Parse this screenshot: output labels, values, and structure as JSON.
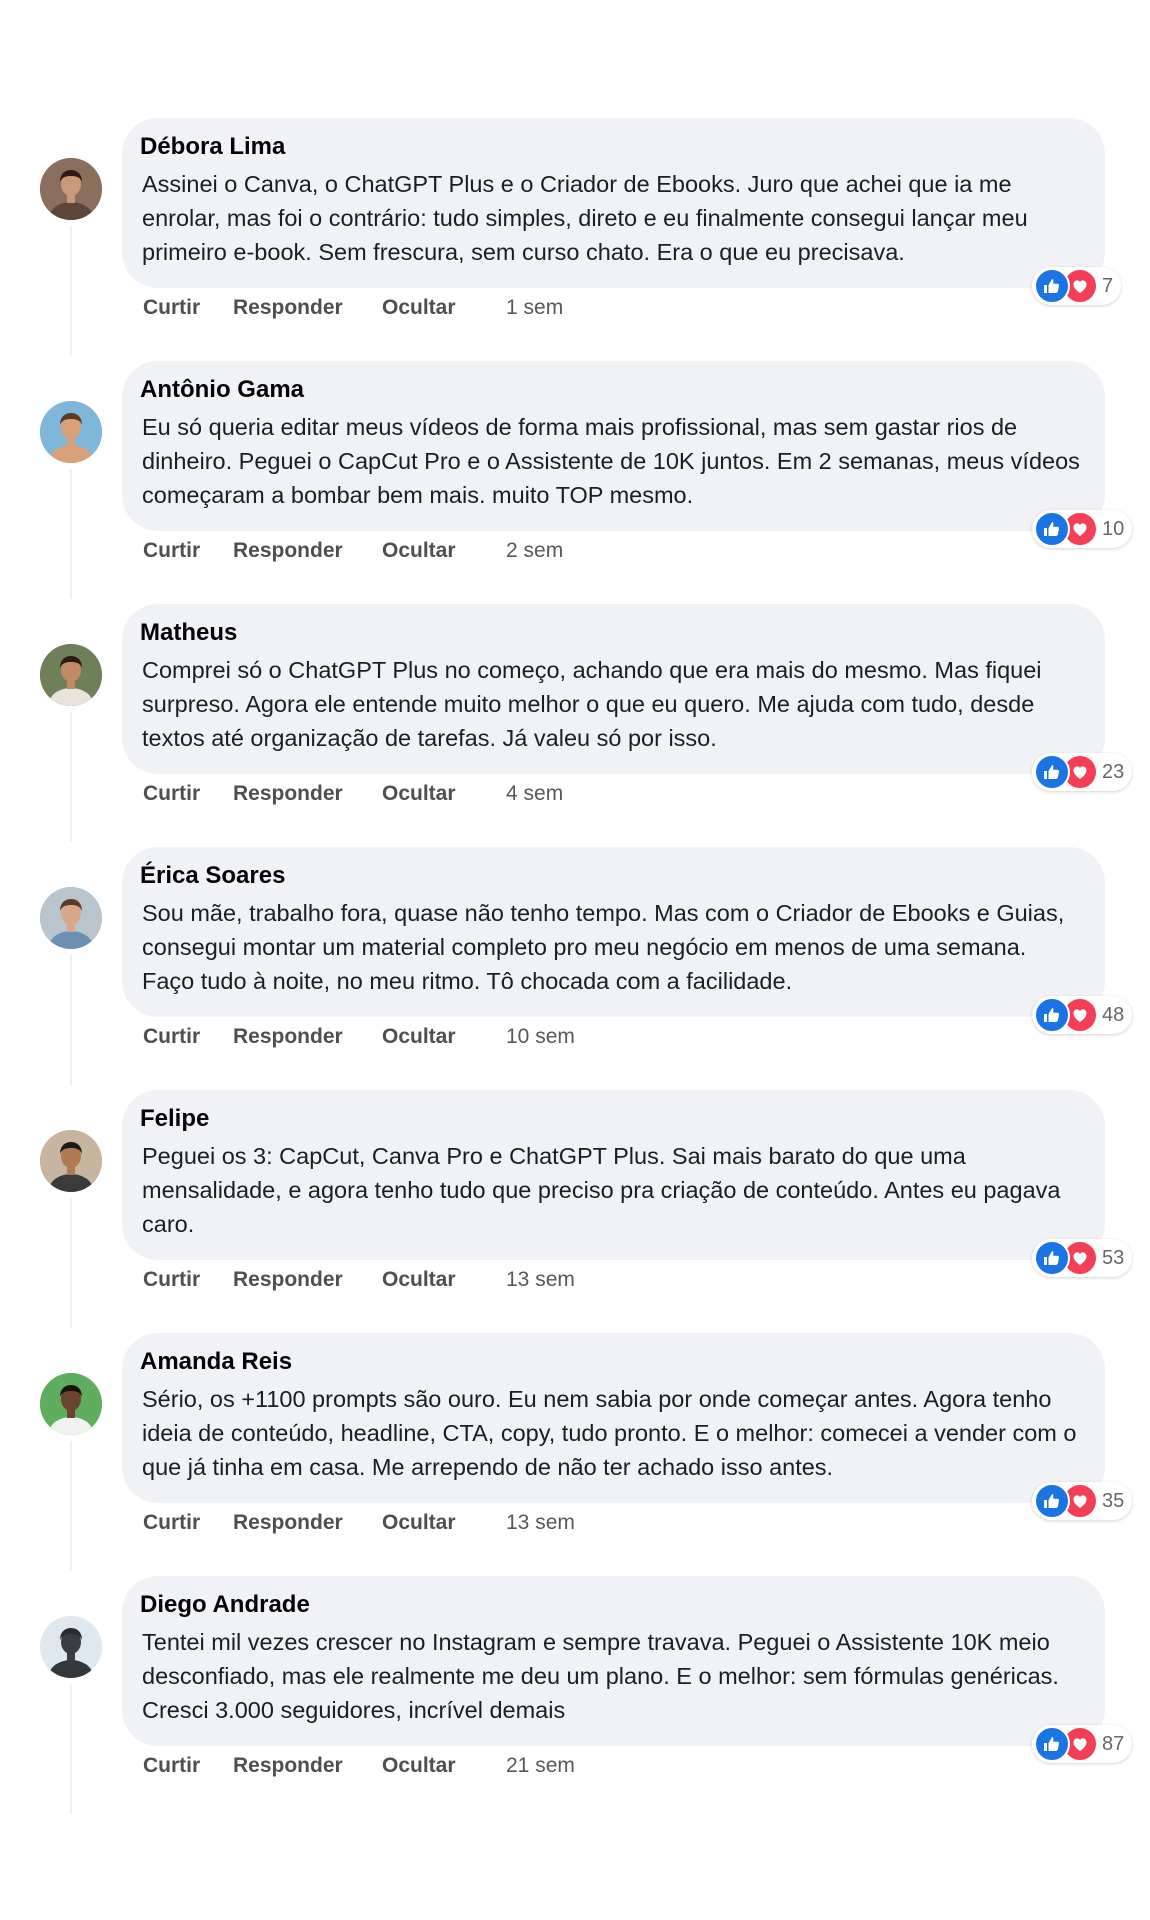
{
  "actions": {
    "like": "Curtir",
    "reply": "Responder",
    "hide": "Ocultar"
  },
  "colors": {
    "like_blue": "#1b74e4",
    "love_red": "#f33e58",
    "bubble_bg": "#f0f2f5"
  },
  "comments": [
    {
      "author": "Débora Lima",
      "text": "Assinei o Canva, o ChatGPT Plus e o Criador de Ebooks. Juro que achei que ia me enrolar, mas foi o contrário: tudo simples, direto e eu finalmente consegui lançar meu primeiro e-book. Sem frescura, sem curso chato. Era o que eu precisava.",
      "time": "1 sem",
      "reactions": "7",
      "avatar": {
        "bg": "#8a6f5c",
        "skin": "#c99a78",
        "hair": "#2c1c14",
        "shirt": "#5b4638"
      }
    },
    {
      "author": "Antônio Gama",
      "text": "Eu só queria editar meus vídeos de forma mais profissional, mas sem gastar rios de dinheiro. Peguei o CapCut Pro e o Assistente de 10K juntos. Em 2 semanas, meus vídeos começaram a bombar bem mais. muito TOP mesmo.",
      "time": "2 sem",
      "reactions": "10",
      "avatar": {
        "bg": "#7fb6d9",
        "skin": "#d9a07a",
        "hair": "#5a3a22",
        "shirt": "#d9a07a"
      }
    },
    {
      "author": "Matheus",
      "text": "Comprei só o ChatGPT Plus no começo, achando que era mais do mesmo. Mas fiquei surpreso. Agora ele entende muito melhor o que eu quero. Me ajuda com tudo, desde textos até organização de tarefas. Já valeu só por isso.",
      "time": "4 sem",
      "reactions": "23",
      "avatar": {
        "bg": "#6f7f5a",
        "skin": "#c08a66",
        "hair": "#2a1d14",
        "shirt": "#e8e4dc"
      }
    },
    {
      "author": "Érica Soares",
      "text": "Sou mãe, trabalho fora, quase não tenho tempo. Mas com o Criador de Ebooks e Guias, consegui montar um material completo pro meu negócio em menos de uma semana. Faço tudo à noite, no meu ritmo. Tô chocada com a facilidade.",
      "time": "10 sem",
      "reactions": "48",
      "avatar": {
        "bg": "#b9c4cc",
        "skin": "#d8a889",
        "hair": "#5c3b26",
        "shirt": "#6b8fb0"
      }
    },
    {
      "author": "Felipe",
      "text": "Peguei os 3: CapCut, Canva Pro e ChatGPT Plus. Sai mais barato do que uma mensalidade, e agora tenho tudo que preciso pra criação de conteúdo. Antes eu pagava caro.",
      "time": "13 sem",
      "reactions": "53",
      "avatar": {
        "bg": "#c7b59f",
        "skin": "#b07a52",
        "hair": "#1e1a17",
        "shirt": "#3b3b3b"
      }
    },
    {
      "author": "Amanda Reis",
      "text": "Sério, os +1100 prompts são ouro. Eu nem sabia por onde começar antes. Agora tenho ideia de conteúdo, headline, CTA, copy, tudo pronto. E o melhor: comecei a vender com o que já tinha em casa. Me arrependo de não ter achado isso antes.",
      "time": "13 sem",
      "reactions": "35",
      "avatar": {
        "bg": "#5fae5f",
        "skin": "#6b4330",
        "hair": "#1b120d",
        "shirt": "#f2f2f2"
      }
    },
    {
      "author": "Diego Andrade",
      "text": "Tentei mil vezes crescer no Instagram e sempre travava. Peguei o Assistente 10K meio desconfiado, mas ele realmente me deu um plano. E o melhor: sem fórmulas genéricas. Cresci 3.000 seguidores, incrível demais",
      "time": "21 sem",
      "reactions": "87",
      "avatar": {
        "bg": "#dfe8ef",
        "skin": "#3a3d42",
        "hair": "#2a2c30",
        "shirt": "#33363b"
      }
    }
  ]
}
